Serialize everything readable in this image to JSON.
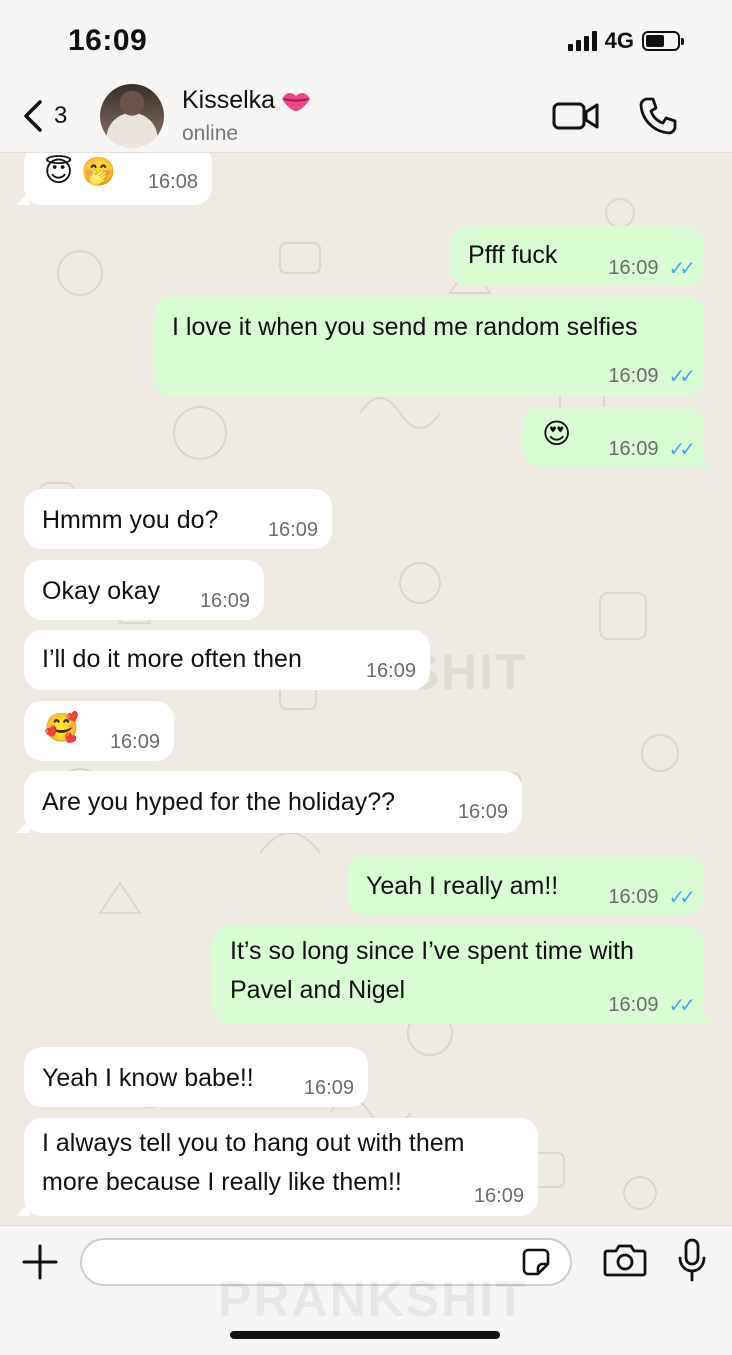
{
  "status_bar": {
    "time": "16:09",
    "network": "4G"
  },
  "header": {
    "back_count": "3",
    "contact_name": "Kisselka",
    "contact_status": "online",
    "icons": [
      "chevron-left-icon",
      "video-call-icon",
      "phone-icon",
      "kiss-mark-icon"
    ]
  },
  "watermark": "PRANKSHIT",
  "messages": [
    {
      "id": "m0",
      "dir": "in",
      "text": "😇 🤭",
      "time": "16:08"
    },
    {
      "id": "m1",
      "dir": "out",
      "text": "Pfff fuck",
      "time": "16:09",
      "read": true
    },
    {
      "id": "m2",
      "dir": "out",
      "text": "I love it when you send me random selfies",
      "time": "16:09",
      "read": true
    },
    {
      "id": "m3",
      "dir": "out",
      "text": "😍",
      "time": "16:09",
      "read": true
    },
    {
      "id": "m4",
      "dir": "in",
      "text": "Hmmm you do?",
      "time": "16:09"
    },
    {
      "id": "m5",
      "dir": "in",
      "text": "Okay okay",
      "time": "16:09"
    },
    {
      "id": "m6",
      "dir": "in",
      "text": "I’ll do it more often then",
      "time": "16:09"
    },
    {
      "id": "m7",
      "dir": "in",
      "text": "🥰",
      "time": "16:09"
    },
    {
      "id": "m8",
      "dir": "in",
      "text": "Are you hyped for the holiday??",
      "time": "16:09"
    },
    {
      "id": "m9",
      "dir": "out",
      "text": "Yeah I really am!!",
      "time": "16:09",
      "read": true
    },
    {
      "id": "m10",
      "dir": "out",
      "line1": "It’s so long since I’ve spent time with",
      "line2": "Pavel and Nigel",
      "time": "16:09",
      "read": true
    },
    {
      "id": "m11",
      "dir": "in",
      "text": "Yeah I know babe!!",
      "time": "16:09"
    },
    {
      "id": "m12",
      "dir": "in",
      "line1": "I always tell you to hang out with them",
      "line2": "more because I really like them!!",
      "time": "16:09"
    }
  ],
  "composer": {
    "placeholder": ""
  },
  "colors": {
    "incoming": "#ffffff",
    "outgoing": "#d9fdd3",
    "read_ticks": "#4aa3f0",
    "chat_bg": "#efeae2"
  }
}
